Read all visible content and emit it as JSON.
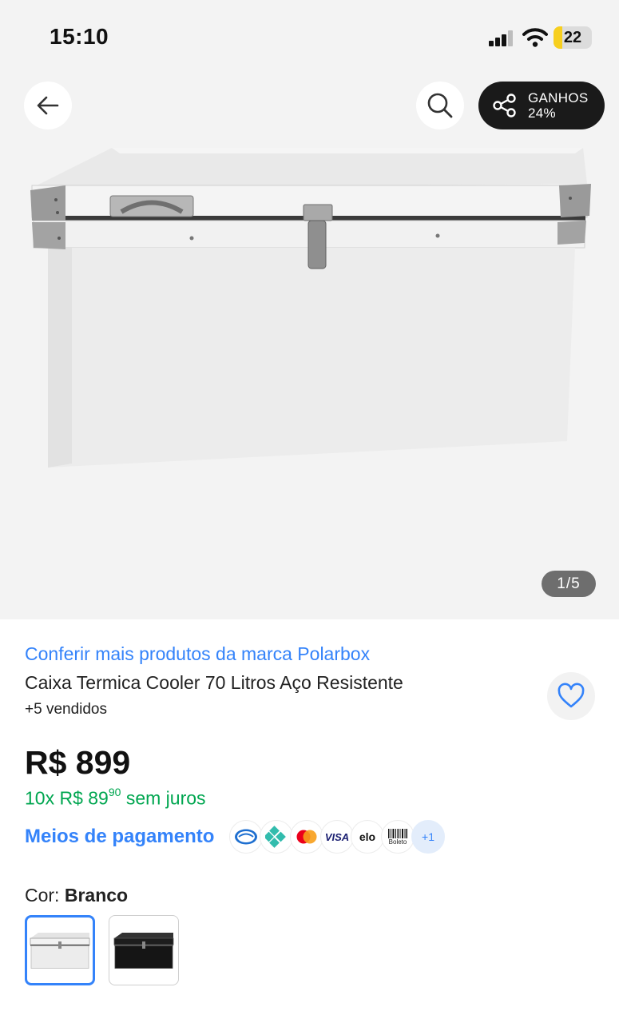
{
  "status_bar": {
    "time": "15:10",
    "battery_level": "22",
    "battery_fraction": 0.22,
    "icons": [
      "signal-icon",
      "wifi-icon",
      "battery-icon"
    ]
  },
  "header": {
    "back_icon": "arrow-left-icon",
    "search_icon": "search-icon",
    "share": {
      "icon": "share-icon",
      "line1": "GANHOS",
      "line2": "24%"
    }
  },
  "gallery": {
    "page_indicator": "1/5",
    "current": 1,
    "total": 5
  },
  "product": {
    "brand_link": "Conferir mais produtos da marca Polarbox",
    "title": "Caixa Termica Cooler 70 Litros Aço Resistente",
    "sold": "+5 vendidos",
    "favorite_icon": "heart-icon",
    "price": "R$ 899",
    "installments_prefix": "10x R$ 89",
    "installments_cents": "90",
    "installments_suffix": "sem juros"
  },
  "payments": {
    "label": "Meios de pagamento",
    "methods": [
      "Mercado Pago",
      "Pix",
      "Mastercard",
      "VISA",
      "elo",
      "Boleto"
    ],
    "visa_text": "VISA",
    "elo_text": "elo",
    "boleto_text": "Boleto",
    "more": "+1"
  },
  "color": {
    "label": "Cor:",
    "selected": "Branco",
    "options": [
      "Branco",
      "Preto"
    ]
  },
  "colors": {
    "accent": "#3483fa",
    "green": "#00a650",
    "background": "#f3f3f3"
  }
}
